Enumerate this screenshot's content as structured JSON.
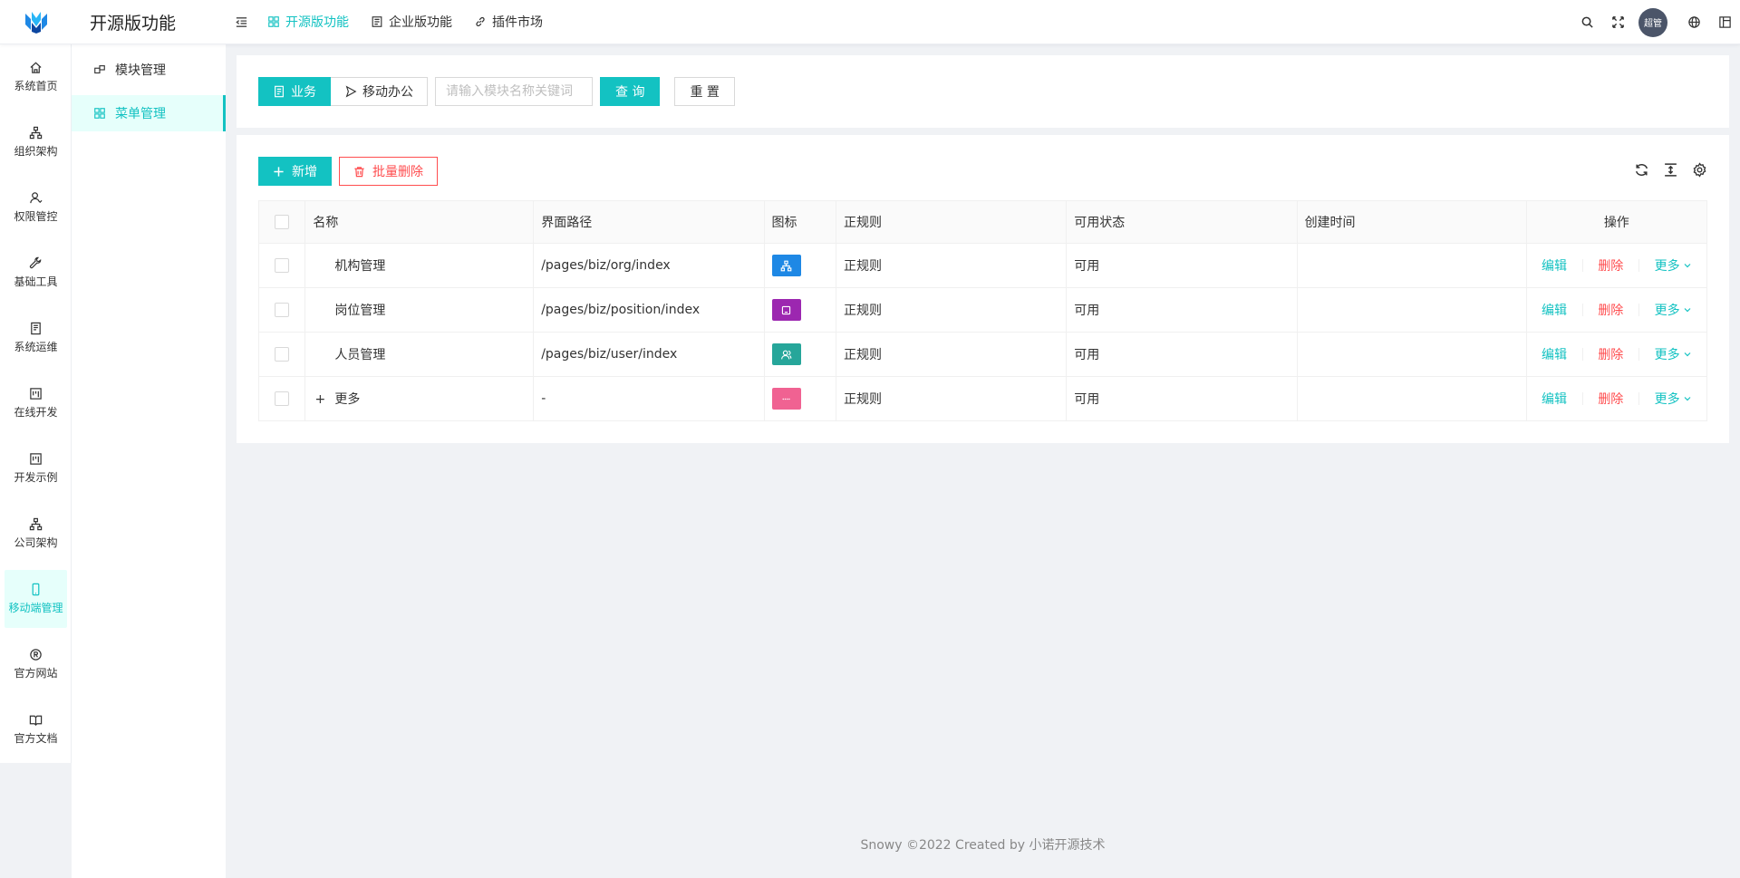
{
  "app": {
    "title": "开源版功能"
  },
  "colors": {
    "primary": "#13c2c2",
    "danger": "#ff4d4f",
    "active_bg": "#e6fffb"
  },
  "topnav": [
    {
      "label": "开源版功能",
      "icon": "appstore-icon",
      "active": true
    },
    {
      "label": "企业版功能",
      "icon": "profile-icon",
      "active": false
    },
    {
      "label": "插件市场",
      "icon": "link-icon",
      "active": false
    }
  ],
  "header": {
    "avatar_text": "超管"
  },
  "rail": [
    {
      "label": "系统首页",
      "icon": "home-icon"
    },
    {
      "label": "组织架构",
      "icon": "cluster-icon"
    },
    {
      "label": "权限管控",
      "icon": "user-icon"
    },
    {
      "label": "基础工具",
      "icon": "tool-icon"
    },
    {
      "label": "系统运维",
      "icon": "book-icon"
    },
    {
      "label": "在线开发",
      "icon": "project-icon"
    },
    {
      "label": "开发示例",
      "icon": "project-icon"
    },
    {
      "label": "公司架构",
      "icon": "cluster-icon"
    },
    {
      "label": "移动端管理",
      "icon": "mobile-icon",
      "active": true
    },
    {
      "label": "官方网站",
      "icon": "registered-icon"
    },
    {
      "label": "官方文档",
      "icon": "read-icon"
    }
  ],
  "sub_menu": [
    {
      "label": "模块管理",
      "icon": "block-icon",
      "active": false
    },
    {
      "label": "菜单管理",
      "icon": "menu-icon",
      "active": true
    }
  ],
  "search": {
    "segments": [
      {
        "label": "业务",
        "icon": "file-text-icon",
        "active": true
      },
      {
        "label": "移动办公",
        "icon": "send-icon",
        "active": false
      }
    ],
    "placeholder": "请输入模块名称关键词",
    "query_label": "查 询",
    "reset_label": "重 置"
  },
  "toolbar": {
    "add_label": "新增",
    "batch_delete_label": "批量删除"
  },
  "table": {
    "columns": [
      "名称",
      "界面路径",
      "图标",
      "正规则",
      "可用状态",
      "创建时间",
      "操作"
    ],
    "rows": [
      {
        "name": "机构管理",
        "path": "/pages/biz/org/index",
        "icon_color": "#1e88e5",
        "icon": "cluster-icon",
        "rule": "正规则",
        "status": "可用",
        "created": "",
        "expandable": false
      },
      {
        "name": "岗位管理",
        "path": "/pages/biz/position/index",
        "icon_color": "#9c27b0",
        "icon": "robot-icon",
        "rule": "正规则",
        "status": "可用",
        "created": "",
        "expandable": false
      },
      {
        "name": "人员管理",
        "path": "/pages/biz/user/index",
        "icon_color": "#26a69a",
        "icon": "team-icon",
        "rule": "正规则",
        "status": "可用",
        "created": "",
        "expandable": false
      },
      {
        "name": "更多",
        "path": "-",
        "icon_color": "#f06292",
        "icon": "more-icon",
        "rule": "正规则",
        "status": "可用",
        "created": "",
        "expandable": true,
        "expand_symbol": "+"
      }
    ],
    "actions": {
      "edit": "编辑",
      "delete": "删除",
      "more": "更多"
    }
  },
  "footer": {
    "text": "Snowy ©2022 Created by 小诺开源技术"
  }
}
